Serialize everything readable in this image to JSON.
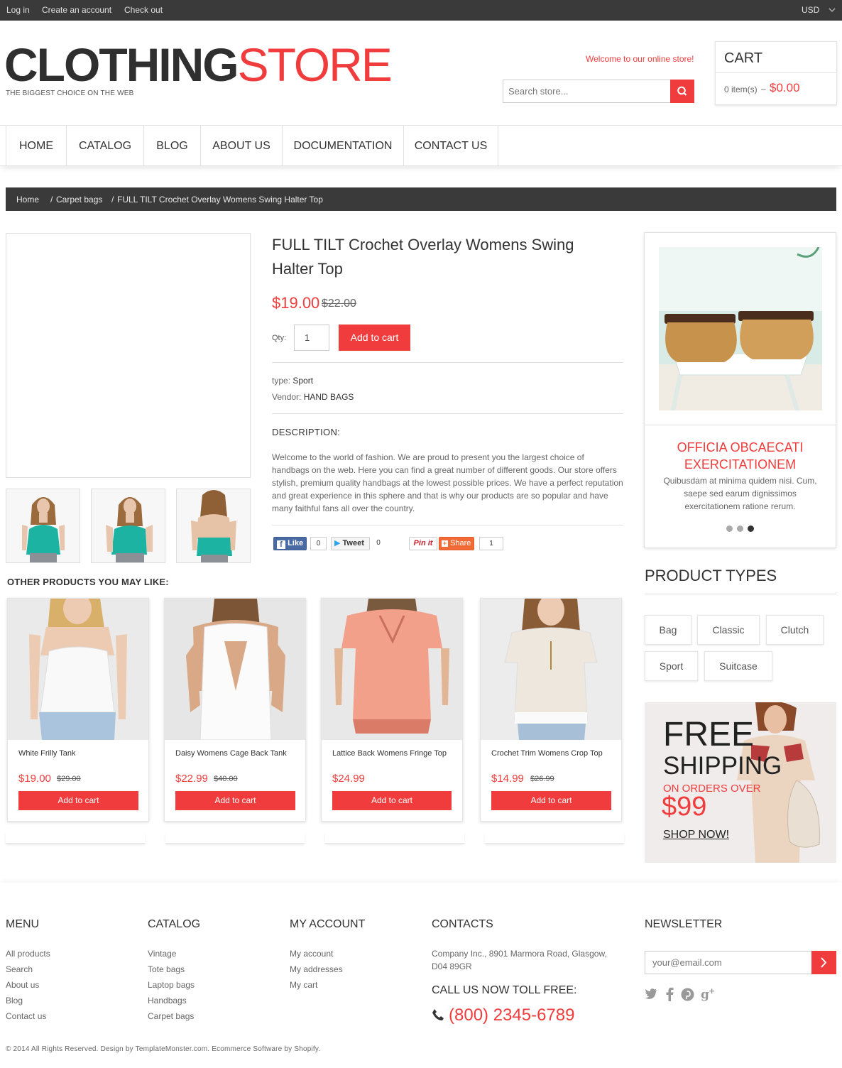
{
  "topbar": {
    "login": "Log in",
    "create_account": "Create an account",
    "checkout": "Check out",
    "currency": "USD"
  },
  "logo": {
    "part1": "CLOTHING",
    "part2": "STORE",
    "tagline": "THE BIGGEST CHOICE ON THE WEB"
  },
  "header": {
    "welcome": "Welcome to our online store!",
    "search_placeholder": "Search store..."
  },
  "cart": {
    "title": "CART",
    "items": "0 item(s)",
    "dash": "–",
    "total": "$0.00"
  },
  "nav": [
    "HOME",
    "CATALOG",
    "BLOG",
    "ABOUT US",
    "DOCUMENTATION",
    "CONTACT US"
  ],
  "breadcrumb": {
    "home": "Home",
    "sep": "/",
    "category": "Carpet bags",
    "current": "FULL TILT Crochet Overlay Womens Swing Halter Top"
  },
  "product": {
    "title": "FULL TILT Crochet Overlay Womens Swing Halter Top",
    "price": "$19.00",
    "old_price": "$22.00",
    "qty_label": "Qty:",
    "qty_value": "1",
    "add_to_cart": "Add to cart",
    "type_label": "type:",
    "type_value": "Sport",
    "vendor_label": "Vendor:",
    "vendor_value": "HAND BAGS",
    "description_heading": "DESCRIPTION:",
    "description": "Welcome to the world of fashion. We are proud to present you the largest choice of handbags on the web. Here you can find a great number of different goods. Our store offers stylish, premium quality handbags at the lowest possible prices. We have a perfect reputation and great experience in this sphere and that is why our products are so popular and have many faithful fans all over the country."
  },
  "social": {
    "like": "Like",
    "like_count": "0",
    "tweet": "Tweet",
    "tweet_count": "0",
    "pin": "Pin it",
    "share": "Share",
    "share_count": "1"
  },
  "slider": {
    "title": "OFFICIA OBCAECATI EXERCITATIONEM",
    "text": "Quibusdam at minima quidem nisi. Cum, saepe sed earum dignissimos exercitationem ratione rerum.",
    "active_slide": 3,
    "slide_count": 3
  },
  "product_types": {
    "heading": "PRODUCT TYPES",
    "tags": [
      "Bag",
      "Classic",
      "Clutch",
      "Sport",
      "Suitcase"
    ]
  },
  "banner": {
    "line1": "FREE",
    "line2": "SHIPPING",
    "line3": "ON ORDERS OVER",
    "amount": "$99",
    "cta": "SHOP NOW!"
  },
  "related": {
    "heading": "OTHER PRODUCTS YOU MAY LIKE:",
    "products": [
      {
        "name": "White Frilly Tank",
        "price": "$19.00",
        "old_price": "$29.00",
        "button": "Add to cart"
      },
      {
        "name": "Daisy Womens Cage Back Tank",
        "price": "$22.99",
        "old_price": "$40.00",
        "button": "Add to cart"
      },
      {
        "name": "Lattice Back Womens Fringe Top",
        "price": "$24.99",
        "old_price": "",
        "button": "Add to cart"
      },
      {
        "name": "Crochet Trim Womens Crop Top",
        "price": "$14.99",
        "old_price": "$26.99",
        "button": "Add to cart"
      }
    ]
  },
  "footer": {
    "menu": {
      "heading": "MENU",
      "links": [
        "All products",
        "Search",
        "About us",
        "Blog",
        "Contact us"
      ]
    },
    "catalog": {
      "heading": "CATALOG",
      "links": [
        "Vintage",
        "Tote bags",
        "Laptop bags",
        "Handbags",
        "Carpet bags"
      ]
    },
    "account": {
      "heading": "MY ACCOUNT",
      "links": [
        "My account",
        "My addresses",
        "My cart"
      ]
    },
    "contacts": {
      "heading": "CONTACTS",
      "address_line1": "Company Inc., 8901 Marmora Road, Glasgow,",
      "address_line2": "D04 89GR",
      "call_heading": "CALL US NOW TOLL FREE:",
      "phone": "(800) 2345-6789"
    },
    "newsletter": {
      "heading": "NEWSLETTER",
      "placeholder": "your@email.com"
    },
    "copyright": "© 2014 All Rights Reserved. Design by TemplateMonster.com. Ecommerce Software by Shopify."
  },
  "colors": {
    "accent": "#f03c3c",
    "dark_bar": "#3a3a3a",
    "text": "#333333"
  }
}
